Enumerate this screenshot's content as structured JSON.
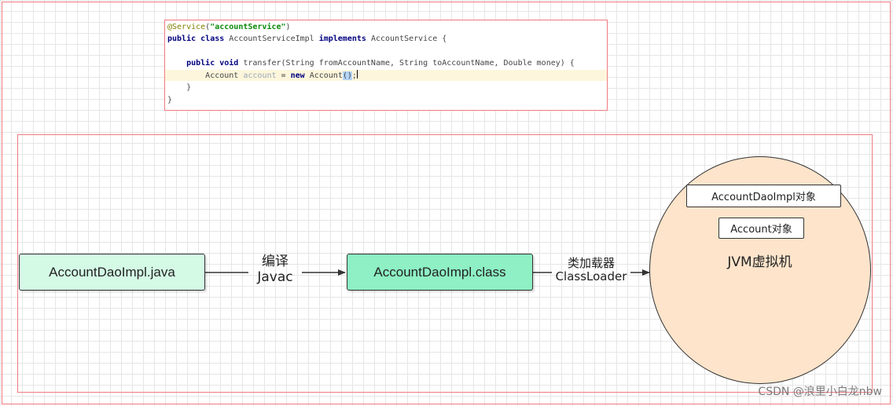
{
  "code": {
    "annotation": "@Service",
    "annotation_arg": "\"accountService\"",
    "class_public": "public",
    "class_kw": "class",
    "class_name": "AccountServiceImpl",
    "implements_kw": "implements",
    "interface_name": "AccountService",
    "open_brace": "{",
    "method_public": "public",
    "method_void": "void",
    "method_sig": "transfer(String fromAccountName, String toAccountName, Double money) {",
    "stmt_type": "Account",
    "stmt_var": "account",
    "stmt_eq": "=",
    "stmt_new": "new",
    "stmt_ctor": "Account",
    "stmt_parens": "()",
    "stmt_semi": ";",
    "method_close": "}",
    "class_close": "}"
  },
  "diagram": {
    "source_file": "AccountDaoImpl.java",
    "compile_label": "编译",
    "compile_tool": "Javac",
    "class_file": "AccountDaoImpl.class",
    "loader_label": "类加载器",
    "loader_tool": "ClassLoader",
    "jvm_objects": [
      "AccountDaoImpl对象",
      "Account对象"
    ],
    "jvm_label": "JVM虚拟机"
  },
  "colors": {
    "frame": "#f07a80",
    "java_box": "#d4fae6",
    "class_box": "#8ef0c4",
    "jvm_fill": "#fde4cb",
    "arrow": "#333333"
  },
  "watermark": "CSDN @浪里小白龙nbw"
}
